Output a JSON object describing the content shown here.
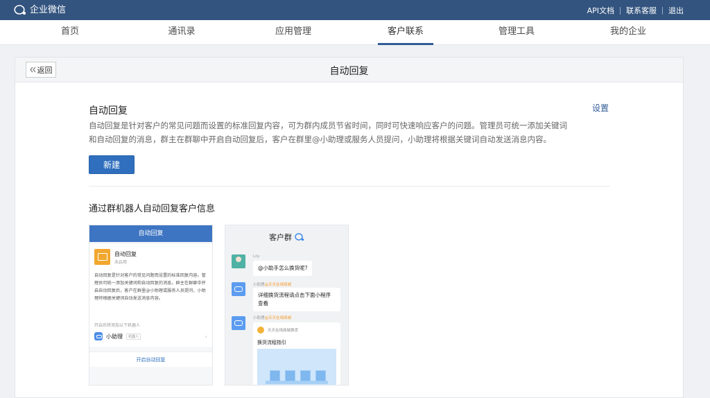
{
  "topbar": {
    "logo_text": "企业微信",
    "links": [
      "API文档",
      "联系客服",
      "退出"
    ]
  },
  "nav": {
    "items": [
      "首页",
      "通讯录",
      "应用管理",
      "客户联系",
      "管理工具",
      "我的企业"
    ],
    "active": "客户联系"
  },
  "page": {
    "back_label": "返回",
    "title": "自动回复",
    "section_title": "自动回复",
    "settings_label": "设置",
    "description": "自动回复是针对客户的常见问题而设置的标准回复内容，可为群内成员节省时间，同时可快速响应客户的问题。管理员可统一添加关键词和自动回复的消息，群主在群聊中开启自动回复后，客户在群里@小助理或服务人员提问，小助理将根据关键词自动发送消息内容。",
    "new_button": "新建",
    "sub_title": "通过群机器人自动回复客户信息"
  },
  "preview1": {
    "header": "自动回复",
    "app_name": "自动回复",
    "app_status": "未启用",
    "desc": "自动回复是针对客户的常见问题而设置的标准回复内容。管理员可统一添加关键词和自动回复的消息。群主在群聊中开启自动回复后，客户在群里@小助理或服务人员提问，小助理将根据关键词自动发送消息内容。",
    "hint": "开启后将添加以下机器人",
    "bot_name": "小助理",
    "bot_tag": "机器人",
    "enable_button": "开启自动回复"
  },
  "preview2": {
    "title": "客户群",
    "msg1_sender": "Lily",
    "msg1_text": "@小助手怎么换货呢?",
    "msg2_sender": "小助理",
    "msg2_org": "@天天在线商城",
    "msg2_text": "详细换货流程请点击下面小程序查看",
    "msg3_sender": "小助理",
    "msg3_org": "@天天在线商城",
    "card_source": "天天在线商城换货",
    "card_title": "换货流程指引"
  },
  "colors": {
    "topbar": "#33547f",
    "accent": "#2f6fbd",
    "nav_active_underline": "#2f5b95"
  }
}
